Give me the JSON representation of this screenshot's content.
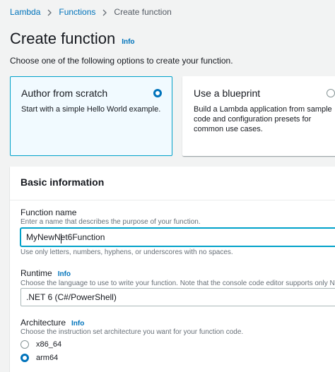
{
  "breadcrumb": {
    "items": [
      "Lambda",
      "Functions"
    ],
    "current": "Create function"
  },
  "page": {
    "title": "Create function",
    "info": "Info",
    "intro": "Choose one of the following options to create your function."
  },
  "options": [
    {
      "title": "Author from scratch",
      "description": "Start with a simple Hello World example.",
      "selected": true
    },
    {
      "title": "Use a blueprint",
      "description": "Build a Lambda application from sample code and configuration presets for common use cases.",
      "selected": false
    }
  ],
  "basic_info": {
    "title": "Basic information",
    "function_name": {
      "label": "Function name",
      "description": "Enter a name that describes the purpose of your function.",
      "value": "MyNewNet6Function",
      "hint": "Use only letters, numbers, hyphens, or underscores with no spaces."
    },
    "runtime": {
      "label": "Runtime",
      "info": "Info",
      "description": "Choose the language to use to write your function. Note that the console code editor supports only Node.js, P",
      "value": ".NET 6 (C#/PowerShell)"
    },
    "architecture": {
      "label": "Architecture",
      "info": "Info",
      "description": "Choose the instruction set architecture you want for your function code.",
      "options": [
        {
          "label": "x86_64",
          "selected": false
        },
        {
          "label": "arm64",
          "selected": true
        }
      ]
    }
  },
  "colors": {
    "link": "#0073bb",
    "selected_border": "#00a1c9",
    "selected_bg": "#f1faff"
  }
}
